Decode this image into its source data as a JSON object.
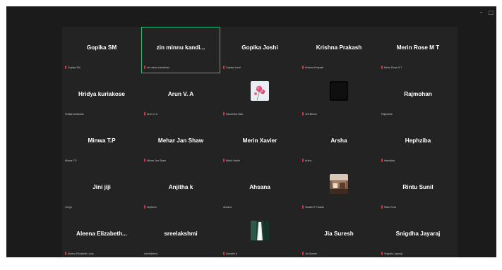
{
  "window": {
    "controls": {
      "minimize": "–",
      "maximize": "□"
    }
  },
  "participants": [
    {
      "name": "Gopika SM",
      "label": "Gopika SM",
      "muted": true,
      "speaking": false,
      "video": ""
    },
    {
      "name": "zin minnu kandi...",
      "label": "zin minnu kandinkal",
      "muted": true,
      "speaking": true,
      "video": ""
    },
    {
      "name": "Gopika Joshi",
      "label": "Gopika Joshi",
      "muted": true,
      "speaking": false,
      "video": ""
    },
    {
      "name": "Krishna Prakash",
      "label": "Krishna Prakash",
      "muted": true,
      "speaking": false,
      "video": ""
    },
    {
      "name": "Merin Rose M T",
      "label": "Merin Rose M T",
      "muted": true,
      "speaking": false,
      "video": ""
    },
    {
      "name": "Hridya kuriakose",
      "label": "Hridya kuriakose",
      "muted": false,
      "speaking": false,
      "video": ""
    },
    {
      "name": "Arun V. A",
      "label": "Arun V. A",
      "muted": true,
      "speaking": false,
      "video": ""
    },
    {
      "name": "",
      "label": "Kaveesha Sasi",
      "muted": true,
      "speaking": false,
      "video": "flower"
    },
    {
      "name": "",
      "label": "Jeff Bence",
      "muted": true,
      "speaking": false,
      "video": "dark"
    },
    {
      "name": "Rajmohan",
      "label": "Rajmohan",
      "muted": false,
      "speaking": false,
      "video": ""
    },
    {
      "name": "Minwa T.P",
      "label": "Minwa T.P",
      "muted": false,
      "speaking": false,
      "video": ""
    },
    {
      "name": "Mehar Jan Shaw",
      "label": "Mehar Jan Shaw",
      "muted": true,
      "speaking": false,
      "video": ""
    },
    {
      "name": "Merin Xavier",
      "label": "Merin Xavier",
      "muted": true,
      "speaking": false,
      "video": ""
    },
    {
      "name": "Arsha",
      "label": "Arsha",
      "muted": true,
      "speaking": false,
      "video": ""
    },
    {
      "name": "Hephziba",
      "label": "Hephziba",
      "muted": true,
      "speaking": false,
      "video": ""
    },
    {
      "name": "Jini jiji",
      "label": "Jini jiji",
      "muted": false,
      "speaking": false,
      "video": ""
    },
    {
      "name": "Anjitha k",
      "label": "Anjitha k",
      "muted": true,
      "speaking": false,
      "video": ""
    },
    {
      "name": "Ahsana",
      "label": "Ahsana",
      "muted": false,
      "speaking": false,
      "video": ""
    },
    {
      "name": "",
      "label": "Swathi S Prasad",
      "muted": true,
      "speaking": false,
      "video": "room"
    },
    {
      "name": "Rintu Sunil",
      "label": "Rintu Sunil",
      "muted": true,
      "speaking": false,
      "video": ""
    },
    {
      "name": "Aleena Elizabeth...",
      "label": "Aleena Elizabeth Louis",
      "muted": true,
      "speaking": false,
      "video": ""
    },
    {
      "name": "sreelakshmi",
      "label": "sreelakshmi",
      "muted": false,
      "speaking": false,
      "video": ""
    },
    {
      "name": "",
      "label": "Aswathi K",
      "muted": true,
      "speaking": false,
      "video": "waterfall"
    },
    {
      "name": "Jia Suresh",
      "label": "Jia Suresh",
      "muted": true,
      "speaking": false,
      "video": ""
    },
    {
      "name": "Snigdha Jayaraj",
      "label": "Snigdha Jayaraj",
      "muted": true,
      "speaking": false,
      "video": ""
    }
  ]
}
